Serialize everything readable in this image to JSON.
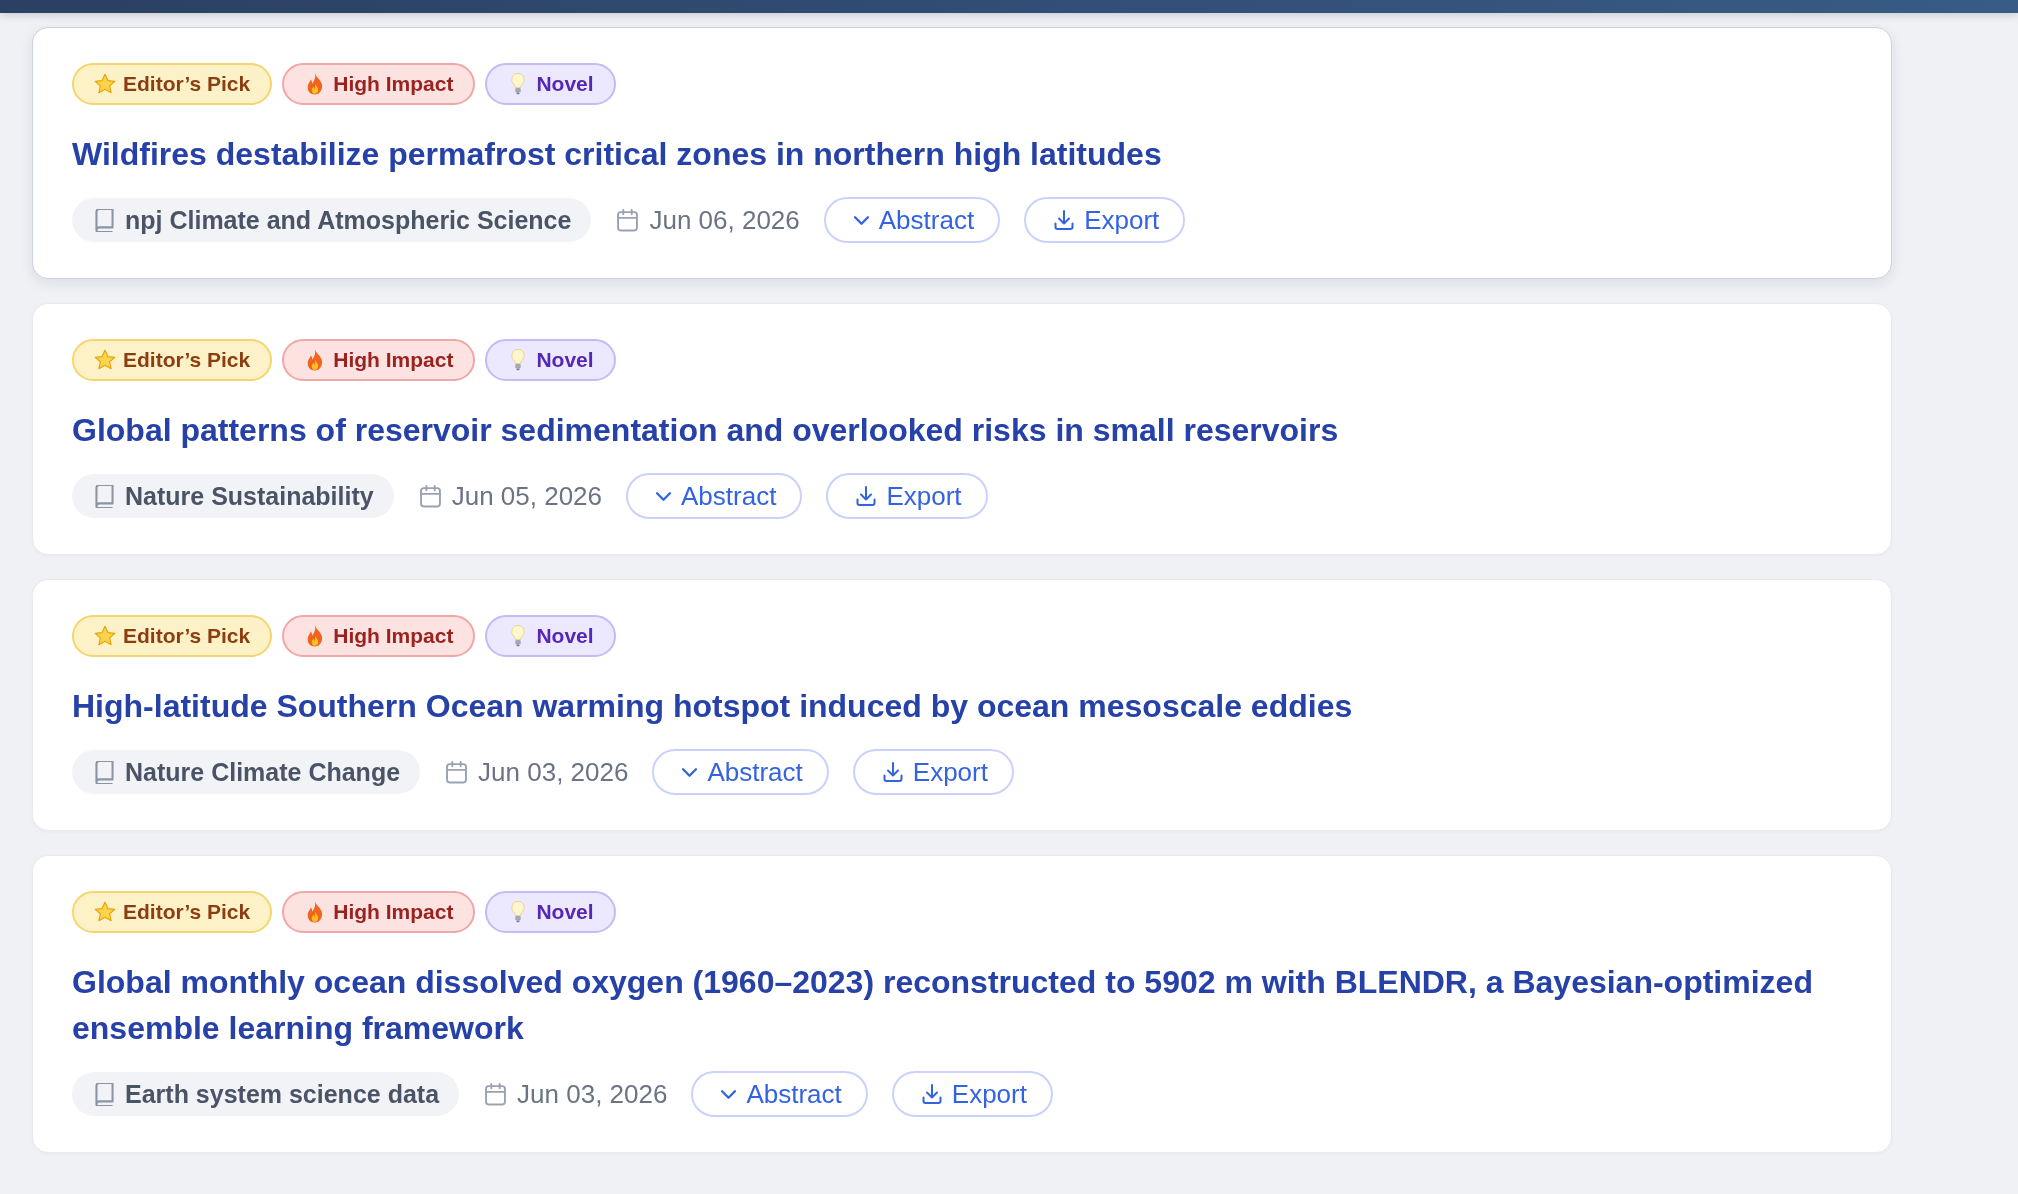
{
  "articles": [
    {
      "hovered": true,
      "badges": [
        {
          "kind": "editors_pick",
          "label": "Editor’s Pick"
        },
        {
          "kind": "high_impact",
          "label": "High Impact"
        },
        {
          "kind": "novel",
          "label": "Novel"
        }
      ],
      "title": "Wildfires destabilize permafrost critical zones in northern high latitudes",
      "journal": "npj Climate and Atmospheric Science",
      "date": "Jun 06, 2026",
      "abstract_button": {
        "label": "Abstract",
        "expanded": false
      },
      "export_button": {
        "label": "Export"
      }
    },
    {
      "hovered": false,
      "badges": [
        {
          "kind": "editors_pick",
          "label": "Editor’s Pick"
        },
        {
          "kind": "high_impact",
          "label": "High Impact"
        },
        {
          "kind": "novel",
          "label": "Novel"
        }
      ],
      "title": "Global patterns of reservoir sedimentation and overlooked risks in small reservoirs",
      "journal": "Nature Sustainability",
      "date": "Jun 05, 2026",
      "abstract_button": {
        "label": "Abstract",
        "expanded": false
      },
      "export_button": {
        "label": "Export"
      }
    },
    {
      "hovered": false,
      "badges": [
        {
          "kind": "editors_pick",
          "label": "Editor’s Pick"
        },
        {
          "kind": "high_impact",
          "label": "High Impact"
        },
        {
          "kind": "novel",
          "label": "Novel"
        }
      ],
      "title": "High-latitude Southern Ocean warming hotspot induced by ocean mesoscale eddies",
      "journal": "Nature Climate Change",
      "date": "Jun 03, 2026",
      "abstract_button": {
        "label": "Abstract",
        "expanded": false
      },
      "export_button": {
        "label": "Export"
      }
    },
    {
      "hovered": false,
      "badges": [
        {
          "kind": "editors_pick",
          "label": "Editor’s Pick"
        },
        {
          "kind": "high_impact",
          "label": "High Impact"
        },
        {
          "kind": "novel",
          "label": "Novel"
        }
      ],
      "title": "Global monthly ocean dissolved oxygen (1960–2023) reconstructed to 5902 m with BLENDR, a Bayesian-optimized ensemble learning framework",
      "journal": "Earth system science data",
      "date": "Jun 03, 2026",
      "abstract_button": {
        "label": "Abstract",
        "expanded": false
      },
      "export_button": {
        "label": "Export"
      }
    }
  ]
}
